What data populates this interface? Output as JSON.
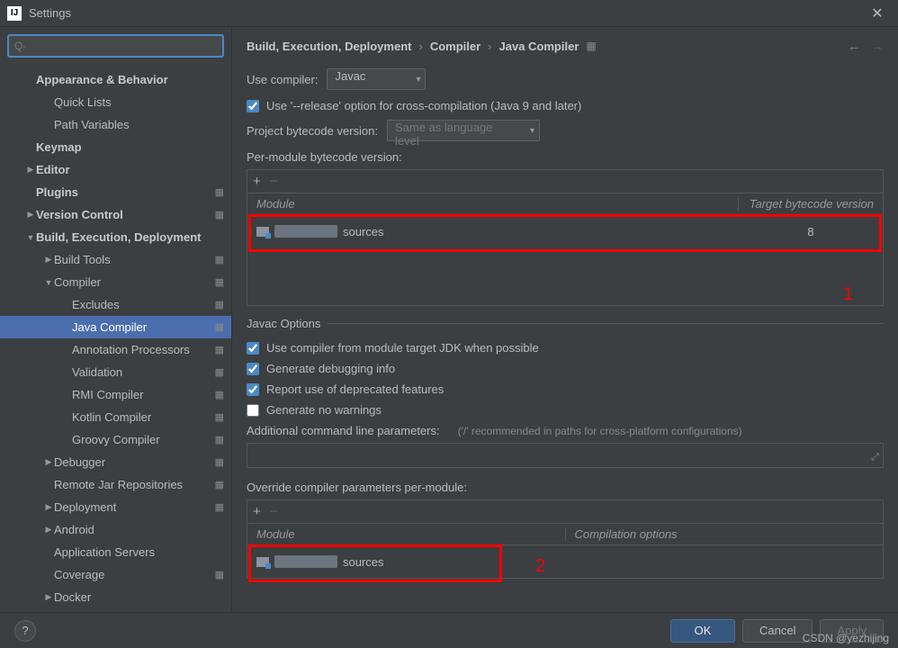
{
  "window": {
    "title": "Settings"
  },
  "search": {
    "placeholder": "Q-"
  },
  "sidebar": {
    "items": [
      {
        "label": "Appearance & Behavior",
        "indent": 1,
        "bold": true
      },
      {
        "label": "Quick Lists",
        "indent": 2
      },
      {
        "label": "Path Variables",
        "indent": 2
      },
      {
        "label": "Keymap",
        "indent": 1,
        "bold": true
      },
      {
        "label": "Editor",
        "indent": 1,
        "bold": true,
        "arrow": ">"
      },
      {
        "label": "Plugins",
        "indent": 1,
        "bold": true,
        "settings": true
      },
      {
        "label": "Version Control",
        "indent": 1,
        "bold": true,
        "arrow": ">",
        "settings": true
      },
      {
        "label": "Build, Execution, Deployment",
        "indent": 1,
        "bold": true,
        "arrow": "v"
      },
      {
        "label": "Build Tools",
        "indent": 2,
        "arrow": ">",
        "settings": true
      },
      {
        "label": "Compiler",
        "indent": 2,
        "arrow": "v",
        "settings": true
      },
      {
        "label": "Excludes",
        "indent": 3,
        "settings": true
      },
      {
        "label": "Java Compiler",
        "indent": 3,
        "settings": true,
        "selected": true
      },
      {
        "label": "Annotation Processors",
        "indent": 3,
        "settings": true
      },
      {
        "label": "Validation",
        "indent": 3,
        "settings": true
      },
      {
        "label": "RMI Compiler",
        "indent": 3,
        "settings": true
      },
      {
        "label": "Kotlin Compiler",
        "indent": 3,
        "settings": true
      },
      {
        "label": "Groovy Compiler",
        "indent": 3,
        "settings": true
      },
      {
        "label": "Debugger",
        "indent": 2,
        "arrow": ">",
        "settings": true
      },
      {
        "label": "Remote Jar Repositories",
        "indent": 2,
        "settings": true
      },
      {
        "label": "Deployment",
        "indent": 2,
        "arrow": ">",
        "settings": true
      },
      {
        "label": "Android",
        "indent": 2,
        "arrow": ">"
      },
      {
        "label": "Application Servers",
        "indent": 2
      },
      {
        "label": "Coverage",
        "indent": 2,
        "settings": true
      },
      {
        "label": "Docker",
        "indent": 2,
        "arrow": ">"
      }
    ]
  },
  "breadcrumb": {
    "part1": "Build, Execution, Deployment",
    "part2": "Compiler",
    "part3": "Java Compiler"
  },
  "compiler": {
    "use_compiler_label": "Use compiler:",
    "use_compiler_value": "Javac",
    "release_option": "Use '--release' option for cross-compilation (Java 9 and later)",
    "project_bytecode_label": "Project bytecode version:",
    "project_bytecode_value": "Same as language level",
    "per_module_label": "Per-module bytecode version:",
    "table1": {
      "col_module": "Module",
      "col_target": "Target bytecode version",
      "row_suffix": "sources",
      "row_target": "8"
    }
  },
  "javac": {
    "legend": "Javac Options",
    "opt1": "Use compiler from module target JDK when possible",
    "opt2": "Generate debugging info",
    "opt3": "Report use of deprecated features",
    "opt4": "Generate no warnings",
    "params_label": "Additional command line parameters:",
    "params_hint": "('/' recommended in paths for cross-platform configurations)",
    "override_label": "Override compiler parameters per-module:",
    "table2": {
      "col_module": "Module",
      "col_opts": "Compilation options",
      "row_suffix": "sources"
    }
  },
  "annotations": {
    "num1": "1",
    "num2": "2"
  },
  "footer": {
    "ok": "OK",
    "cancel": "Cancel",
    "apply": "Apply"
  },
  "watermark": "CSDN @yezhijing"
}
